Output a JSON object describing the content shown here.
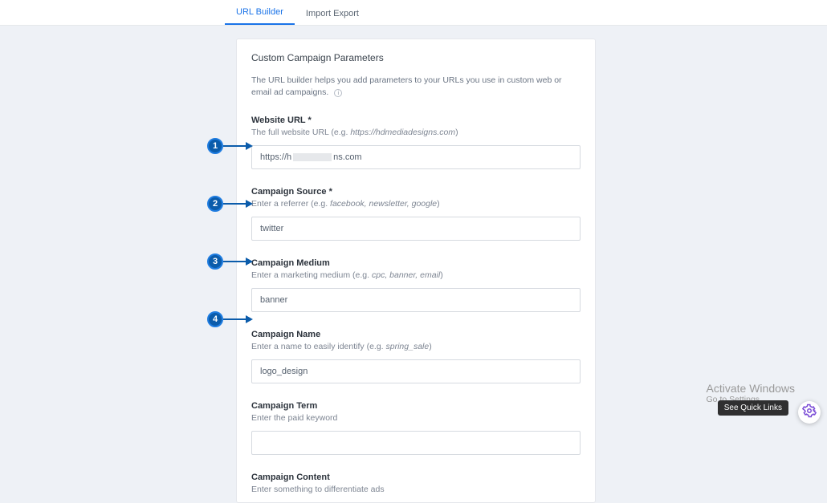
{
  "tabs": {
    "url_builder": "URL Builder",
    "import_export": "Import Export"
  },
  "panel": {
    "title": "Custom Campaign Parameters",
    "description": "The URL builder helps you add parameters to your URLs you use in custom web or email ad campaigns."
  },
  "fields": {
    "website_url": {
      "label": "Website URL *",
      "hint_prefix": "The full website URL (e.g. ",
      "hint_example": "https://hdmediadesigns.com",
      "hint_suffix": ")",
      "value_prefix": "https://h",
      "value_suffix": "ns.com"
    },
    "campaign_source": {
      "label": "Campaign Source *",
      "hint_prefix": "Enter a referrer (e.g. ",
      "hint_example": "facebook, newsletter, google",
      "hint_suffix": ")",
      "value": "twitter"
    },
    "campaign_medium": {
      "label": "Campaign Medium",
      "hint_prefix": "Enter a marketing medium (e.g. ",
      "hint_example": "cpc, banner, email",
      "hint_suffix": ")",
      "value": "banner"
    },
    "campaign_name": {
      "label": "Campaign Name",
      "hint_prefix": "Enter a name to easily identify (e.g. ",
      "hint_example": "spring_sale",
      "hint_suffix": ")",
      "value": "logo_design"
    },
    "campaign_term": {
      "label": "Campaign Term",
      "hint": "Enter the paid keyword",
      "value": ""
    },
    "campaign_content": {
      "label": "Campaign Content",
      "hint": "Enter something to differentiate ads",
      "value": ""
    }
  },
  "annotations": {
    "1": "1",
    "2": "2",
    "3": "3",
    "4": "4"
  },
  "os_watermark": {
    "line1": "Activate Windows",
    "line2": "Go to Settings"
  },
  "quick_links": "See Quick Links"
}
